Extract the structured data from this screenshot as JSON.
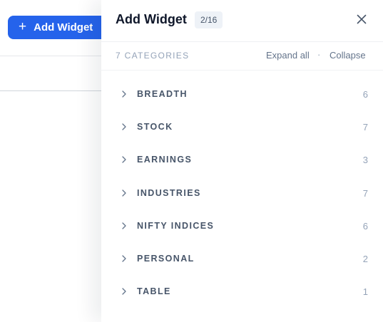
{
  "background": {
    "add_widget_button": {
      "plus": "+",
      "label": "Add Widget"
    }
  },
  "drawer": {
    "title": "Add Widget",
    "count_badge": "2/16",
    "categories_label": "7 CATEGORIES",
    "expand_all": "Expand all",
    "separator": "·",
    "collapse": "Collapse",
    "categories": [
      {
        "label": "BREADTH",
        "count": "6"
      },
      {
        "label": "STOCK",
        "count": "7"
      },
      {
        "label": "EARNINGS",
        "count": "3"
      },
      {
        "label": "INDUSTRIES",
        "count": "7"
      },
      {
        "label": "NIFTY INDICES",
        "count": "6"
      },
      {
        "label": "PERSONAL",
        "count": "2"
      },
      {
        "label": "TABLE",
        "count": "1"
      }
    ]
  },
  "colors": {
    "accent": "#2563eb",
    "title": "#0f172a",
    "muted": "#94a3b8",
    "label": "#475569"
  },
  "icons": {
    "plus": "plus-icon",
    "close": "close-icon",
    "chevron": "chevron-right-icon"
  }
}
